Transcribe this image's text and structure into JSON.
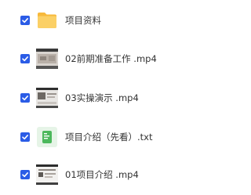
{
  "colors": {
    "checkbox": "#2b5ce6",
    "folder": "#f9c950",
    "txt": "#5cc46a",
    "text": "#333333"
  },
  "files": [
    {
      "name": "项目资料",
      "icon": "folder-icon",
      "checked": true
    },
    {
      "name": "02前期准备工作 .mp4",
      "icon": "video-thumbnail",
      "checked": true
    },
    {
      "name": "03实操演示 .mp4",
      "icon": "video-thumbnail",
      "checked": true
    },
    {
      "name": "项目介绍（先看）.txt",
      "icon": "txt-file-icon",
      "checked": true
    },
    {
      "name": "01项目介绍 .mp4",
      "icon": "video-thumbnail",
      "checked": true
    }
  ]
}
